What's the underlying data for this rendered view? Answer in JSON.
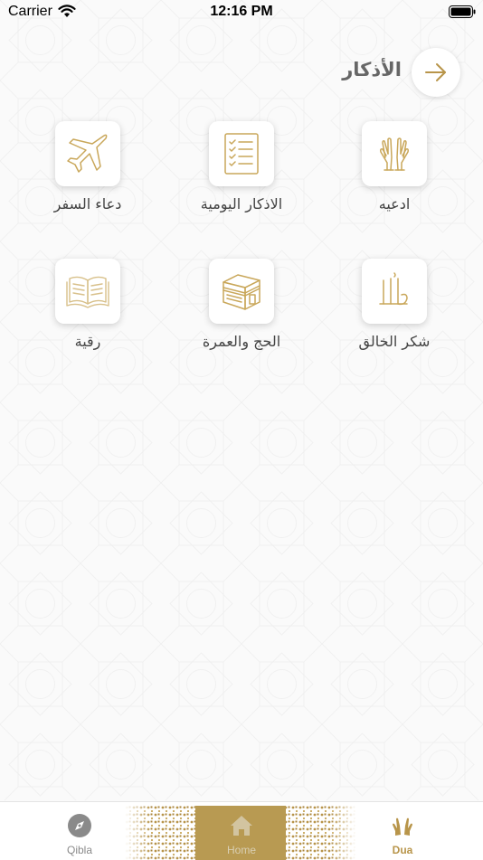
{
  "status_bar": {
    "carrier": "Carrier",
    "time": "12:16 PM"
  },
  "header": {
    "title": "الأذكار",
    "back_icon": "arrow-right-icon"
  },
  "items": [
    {
      "label": "ادعيه",
      "icon": "praying-hands-icon"
    },
    {
      "label": "الاذكار اليومية",
      "icon": "checklist-icon"
    },
    {
      "label": "دعاء السفر",
      "icon": "airplane-icon"
    },
    {
      "label": "شكر الخالق",
      "icon": "allah-calligraphy-icon"
    },
    {
      "label": "الحج والعمرة",
      "icon": "kaaba-icon"
    },
    {
      "label": "رقية",
      "icon": "open-quran-icon"
    }
  ],
  "tabs": [
    {
      "label": "Qibla",
      "icon": "compass-icon",
      "active": false
    },
    {
      "label": "Home",
      "icon": "home-icon",
      "active": false
    },
    {
      "label": "Dua",
      "icon": "praying-hands-icon",
      "active": true
    }
  ],
  "colors": {
    "accent": "#b8954a",
    "tile_stroke": "#c9a75a",
    "inactive_tab": "#8a8a8a",
    "title": "#666666"
  }
}
